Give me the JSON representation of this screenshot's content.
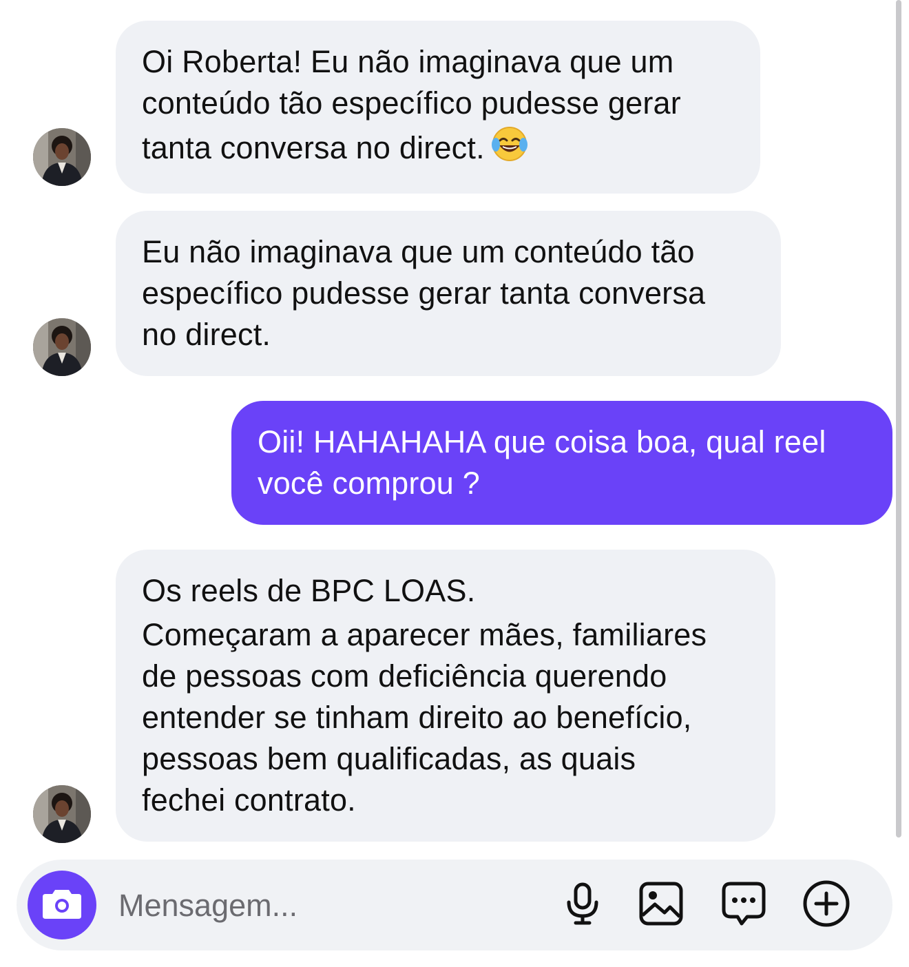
{
  "conversation": {
    "messages": [
      {
        "direction": "incoming",
        "lines": [
          "Oi Roberta! Eu não imaginava que um",
          "conteúdo tão específico pudesse gerar",
          "tanta conversa no direct."
        ],
        "emoji": "face-with-tears-of-joy"
      },
      {
        "direction": "incoming",
        "lines": [
          "Eu não imaginava que um conteúdo tão",
          "específico pudesse gerar tanta conversa",
          "no direct."
        ]
      },
      {
        "direction": "outgoing",
        "lines": [
          "Oii! HAHAHAHA que coisa boa, qual reel",
          "você comprou ?"
        ]
      },
      {
        "direction": "incoming",
        "lines": [
          "Os reels de BPC LOAS.",
          "Começaram a aparecer mães, familiares",
          "de pessoas com deficiência querendo",
          "entender se tinham direito ao benefício,",
          "pessoas bem qualificadas, as quais",
          "fechei contrato."
        ]
      }
    ]
  },
  "composer": {
    "placeholder": "Mensagem...",
    "value": "",
    "icons": [
      "camera-icon",
      "microphone-icon",
      "gallery-icon",
      "sticker-chat-icon",
      "plus-circle-icon"
    ]
  },
  "colors": {
    "incoming_bubble": "#eff1f5",
    "outgoing_bubble": "#6a42f8",
    "camera_button": "#6a42f8",
    "placeholder_text": "#6b6b70"
  }
}
